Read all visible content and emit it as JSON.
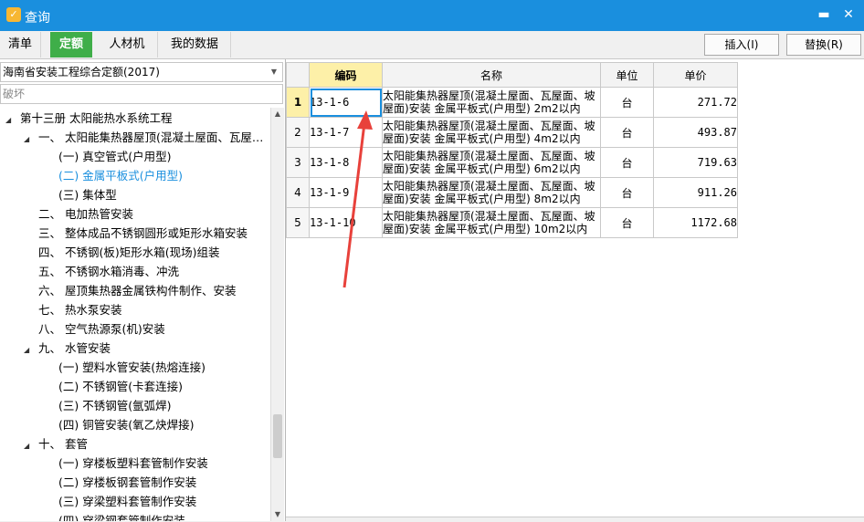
{
  "window": {
    "title": "查询",
    "icon": "app-logo-icon",
    "minimize_glyph": "▬",
    "close_glyph": "✕"
  },
  "tabs": [
    {
      "label": "清单",
      "active": false
    },
    {
      "label": "定额",
      "active": true
    },
    {
      "label": "人材机",
      "active": false
    },
    {
      "label": "我的数据",
      "active": false
    }
  ],
  "toolbar": {
    "insert_label": "插入(I)",
    "replace_label": "替换(R)"
  },
  "left": {
    "quota_library": "海南省安装工程综合定额(2017)",
    "search_value": "破坏",
    "tree": [
      {
        "label": "第十三册  太阳能热水系统工程",
        "expanded": true
      },
      {
        "label": "一、  太阳能集热器屋顶(混凝土屋面、瓦屋…",
        "expanded": true
      },
      {
        "label": "(一) 真空管式(户用型)"
      },
      {
        "label": "(二) 金属平板式(户用型)",
        "selected": true
      },
      {
        "label": "(三) 集体型"
      },
      {
        "label": "二、  电加热管安装"
      },
      {
        "label": "三、  整体成品不锈钢圆形或矩形水箱安装"
      },
      {
        "label": "四、  不锈钢(板)矩形水箱(现场)组装"
      },
      {
        "label": "五、  不锈钢水箱消毒、冲洗"
      },
      {
        "label": "六、  屋顶集热器金属铁构件制作、安装"
      },
      {
        "label": "七、  热水泵安装"
      },
      {
        "label": "八、  空气热源泵(机)安装"
      },
      {
        "label": "九、  水管安装",
        "expanded": true
      },
      {
        "label": "(一) 塑料水管安装(热熔连接)"
      },
      {
        "label": "(二) 不锈钢管(卡套连接)"
      },
      {
        "label": "(三) 不锈钢管(氩弧焊)"
      },
      {
        "label": "(四) 铜管安装(氧乙炔焊接)"
      },
      {
        "label": "十、  套管",
        "expanded": true
      },
      {
        "label": "(一) 穿楼板塑料套管制作安装"
      },
      {
        "label": "(二) 穿楼板钢套管制作安装"
      },
      {
        "label": "(三) 穿梁塑料套管制作安装"
      },
      {
        "label": "(四) 穿梁钢套管制作安装"
      }
    ]
  },
  "grid": {
    "headers": {
      "code": "编码",
      "name": "名称",
      "unit": "单位",
      "price": "单价"
    },
    "rows": [
      {
        "no": "1",
        "code": "13-1-6",
        "name": "太阳能集热器屋顶(混凝土屋面、瓦屋面、坡屋面)安装 金属平板式(户用型) 2m2以内",
        "unit": "台",
        "price": "271.72"
      },
      {
        "no": "2",
        "code": "13-1-7",
        "name": "太阳能集热器屋顶(混凝土屋面、瓦屋面、坡屋面)安装 金属平板式(户用型) 4m2以内",
        "unit": "台",
        "price": "493.87"
      },
      {
        "no": "3",
        "code": "13-1-8",
        "name": "太阳能集热器屋顶(混凝土屋面、瓦屋面、坡屋面)安装 金属平板式(户用型) 6m2以内",
        "unit": "台",
        "price": "719.63"
      },
      {
        "no": "4",
        "code": "13-1-9",
        "name": "太阳能集热器屋顶(混凝土屋面、瓦屋面、坡屋面)安装 金属平板式(户用型) 8m2以内",
        "unit": "台",
        "price": "911.26"
      },
      {
        "no": "5",
        "code": "13-1-10",
        "name": "太阳能集热器屋顶(混凝土屋面、瓦屋面、坡屋面)安装 金属平板式(户用型) 10m2以内",
        "unit": "台",
        "price": "1172.68"
      }
    ]
  },
  "colors": {
    "titlebar": "#1a8fde",
    "active_tab": "#3fae49",
    "selected_node": "#1a8fde",
    "highlight": "#fdf0a8",
    "annotation_arrow": "#e8413b"
  }
}
